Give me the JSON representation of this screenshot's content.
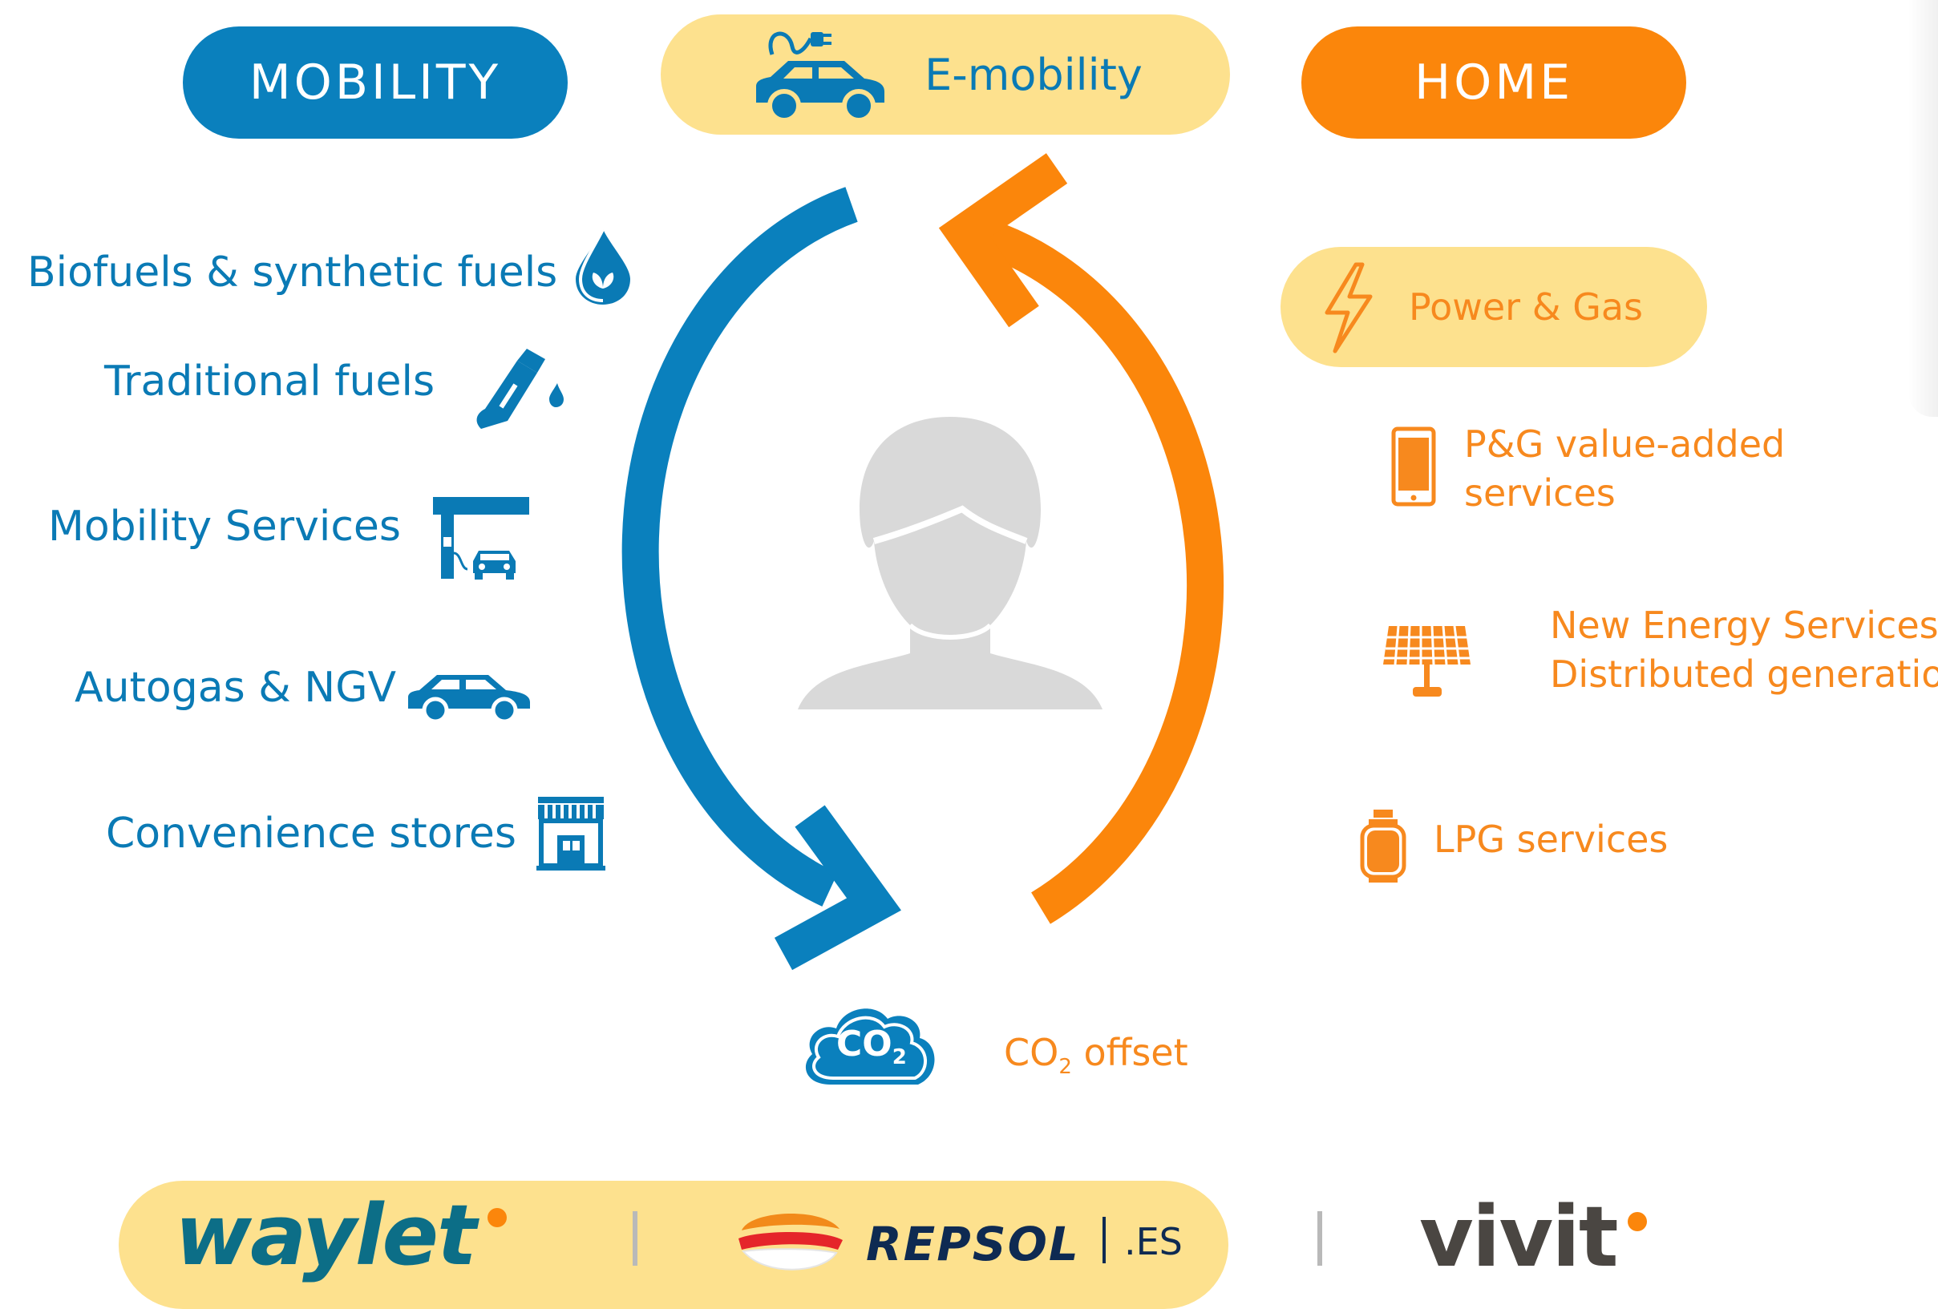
{
  "header": {
    "mobility_label": "MOBILITY",
    "emobility_label": "E-mobility",
    "home_label": "HOME"
  },
  "mobility_items": [
    {
      "label": "Biofuels & synthetic fuels",
      "icon": "water-drop-leaf-icon"
    },
    {
      "label": "Traditional fuels",
      "icon": "fuel-nozzle-icon"
    },
    {
      "label": "Mobility Services",
      "icon": "gas-station-car-icon"
    },
    {
      "label": "Autogas & NGV",
      "icon": "car-icon"
    },
    {
      "label": "Convenience stores",
      "icon": "store-icon"
    }
  ],
  "home_items": {
    "power_gas": {
      "label": "Power & Gas",
      "icon": "lightning-bolt-icon"
    },
    "pg_value_added": {
      "line1": "P&G value-added",
      "line2": "services",
      "icon": "smartphone-icon"
    },
    "new_energy": {
      "line1": "New Energy Services –",
      "line2": "Distributed generation",
      "icon": "solar-panel-icon"
    },
    "lpg": {
      "label": "LPG services",
      "icon": "gas-cylinder-icon"
    }
  },
  "co2": {
    "cloud_text": "CO",
    "cloud_sub": "2",
    "label_prefix": "CO",
    "label_sub": "2",
    "label_suffix": " offset"
  },
  "brands": {
    "waylet": "waylet",
    "repsol": "REPSOL",
    "repsol_domain": ".ES",
    "vivit": "vivit"
  },
  "colors": {
    "blue": "#0a80bd",
    "orange": "#fb860b",
    "yellow": "#fde18e",
    "gray": "#d9d9d9"
  }
}
